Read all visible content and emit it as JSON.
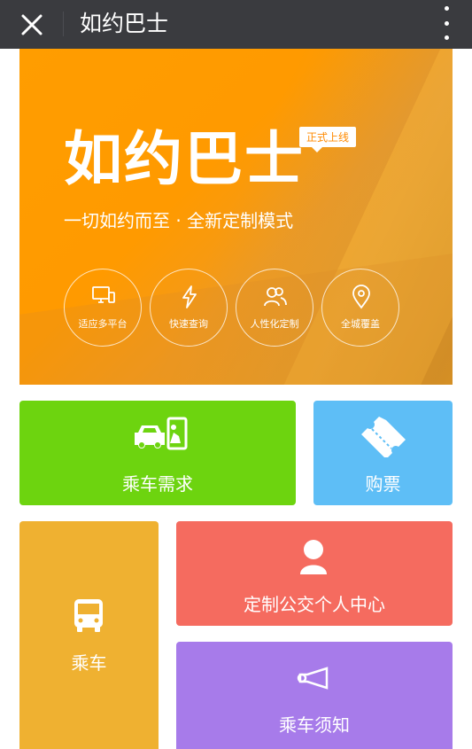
{
  "topbar": {
    "title": "如约巴士",
    "close_icon": "close-icon",
    "more_icon": "more-vertical-icon"
  },
  "banner": {
    "brand": "如约巴士",
    "badge": "正式上线",
    "slogan": "一切如约而至 · 全新定制模式",
    "features": [
      {
        "label": "适应多平台",
        "icon": "devices-icon"
      },
      {
        "label": "快速查询",
        "icon": "lightning-icon"
      },
      {
        "label": "人性化定制",
        "icon": "users-icon"
      },
      {
        "label": "全城覆盖",
        "icon": "location-pin-icon"
      }
    ]
  },
  "tiles": {
    "demand": {
      "label": "乘车需求",
      "color": "#6dd40f",
      "icon": "bus-stop-icon"
    },
    "ticket": {
      "label": "购票",
      "color": "#5ebef6",
      "icon": "ticket-icon"
    },
    "ride": {
      "label": "乘车",
      "color": "#efb131",
      "icon": "bus-icon"
    },
    "center": {
      "label": "定制公交个人中心",
      "color": "#f56b5f",
      "icon": "person-icon"
    },
    "notice": {
      "label": "乘车须知",
      "color": "#a77bea",
      "icon": "horn-icon"
    }
  }
}
